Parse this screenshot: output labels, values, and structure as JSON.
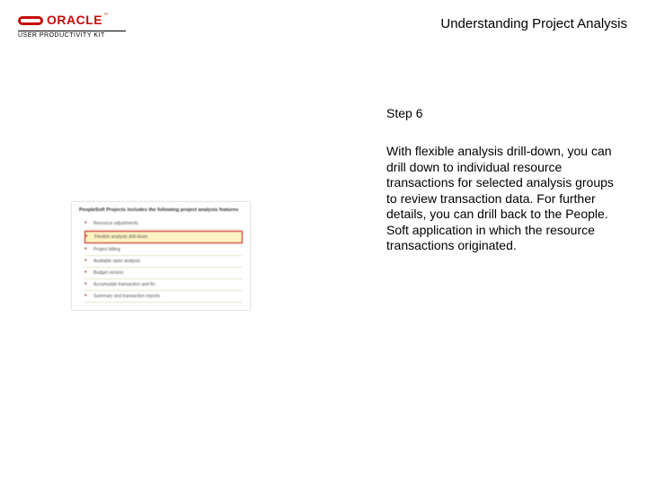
{
  "header": {
    "brand_word": "ORACLE",
    "brand_sub": "USER PRODUCTIVITY KIT",
    "title": "Understanding Project Analysis"
  },
  "thumb": {
    "heading": "PeopleSoft Projects includes the following project analysis features",
    "items": [
      "Resource adjustments",
      "Flexible analysis drill-down",
      "Project billing",
      "Available open analysis",
      "Budget version",
      "Accumulate transaction and fin.",
      "Summary and transaction reports"
    ]
  },
  "content": {
    "step_label": "Step 6",
    "body": "With flexible analysis drill-down, you can drill down to individual resource transactions for selected analysis groups to review transaction data. For further details, you can drill back to the People. Soft application in which the resource transactions originated."
  }
}
